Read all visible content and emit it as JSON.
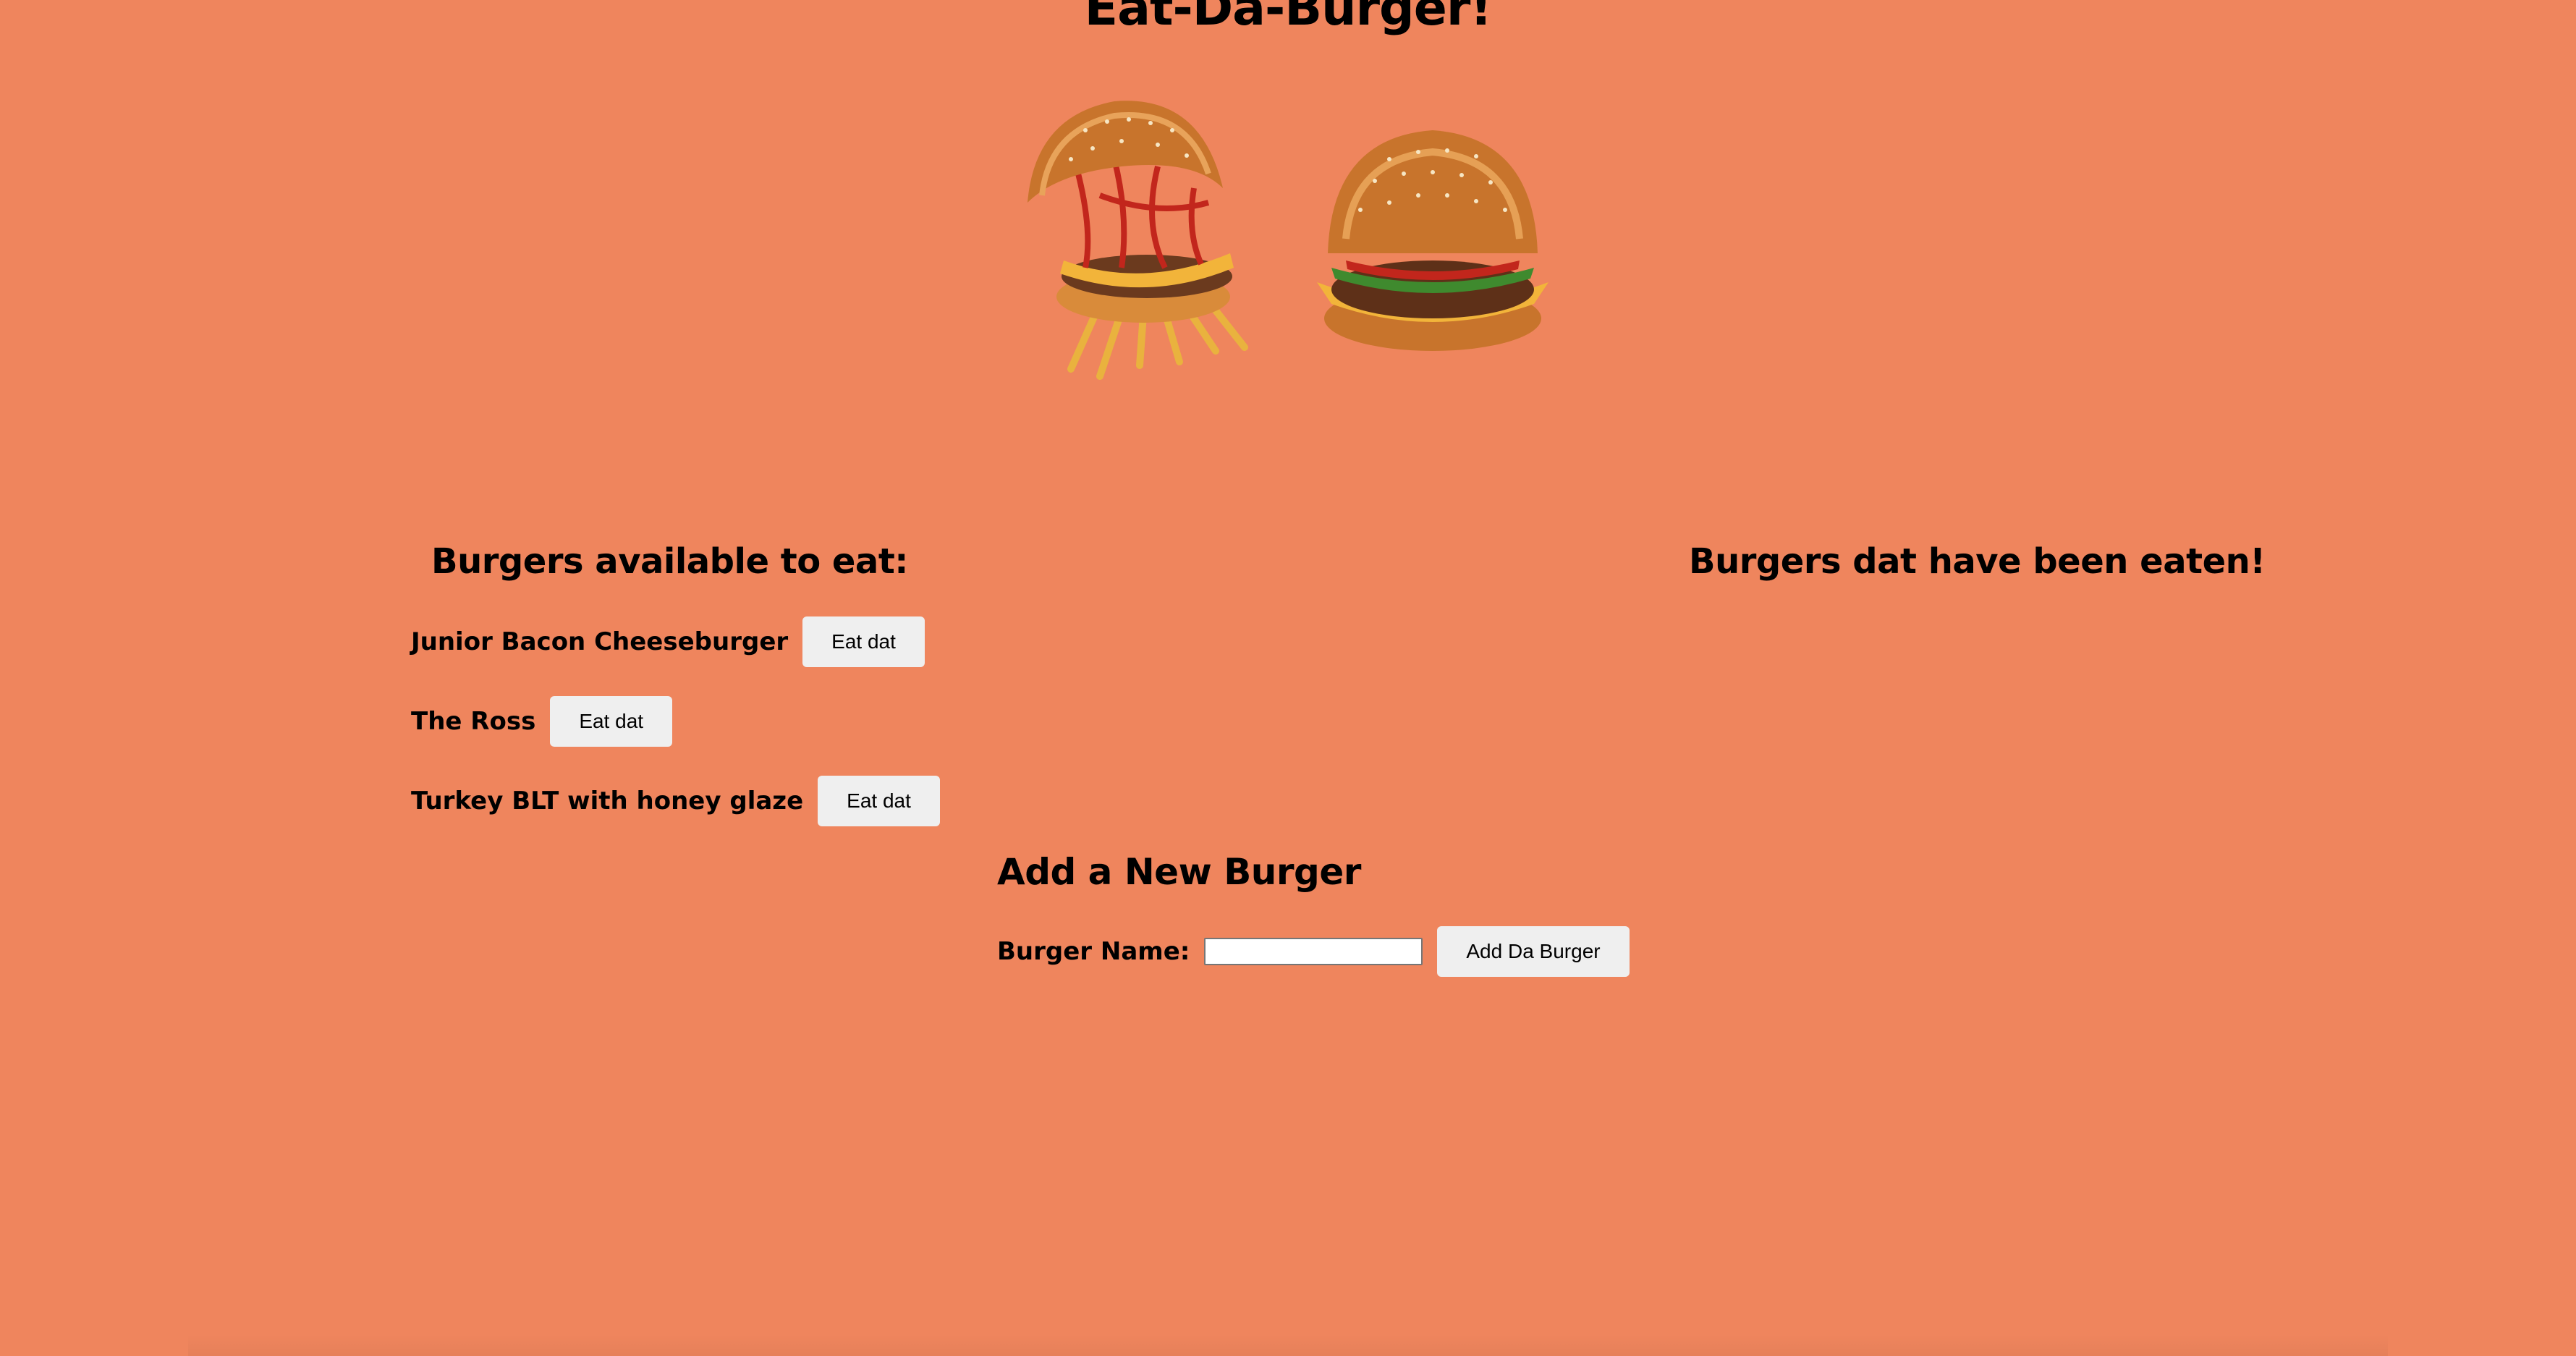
{
  "page": {
    "title": "Eat-Da-Burger!"
  },
  "colors": {
    "background": "#ef855d",
    "button_bg": "#efefef"
  },
  "available": {
    "heading": "Burgers available to eat:",
    "items": [
      {
        "name": "Junior Bacon Cheeseburger",
        "button": "Eat dat"
      },
      {
        "name": "The Ross",
        "button": "Eat dat"
      },
      {
        "name": "Turkey BLT with honey glaze",
        "button": "Eat dat"
      }
    ]
  },
  "eaten": {
    "heading": "Burgers dat have been eaten!",
    "items": []
  },
  "new_burger": {
    "heading": "Add a New Burger",
    "label": "Burger Name:",
    "input_value": "",
    "submit_label": "Add Da Burger"
  }
}
